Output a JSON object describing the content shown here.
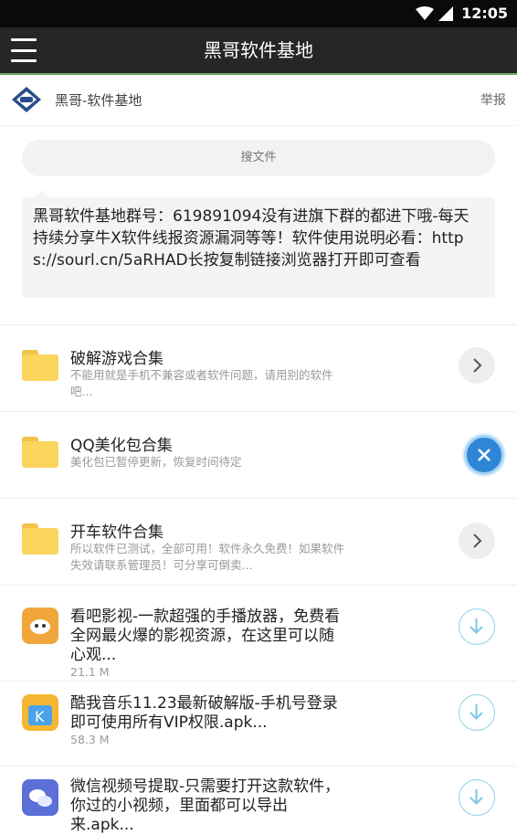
{
  "status_bar": {
    "time": "12:05"
  },
  "app_bar": {
    "title": "黑哥软件基地",
    "menu_icon": "hamburger-icon"
  },
  "header": {
    "name": "黑哥-软件基地",
    "report_label": "举报"
  },
  "search": {
    "placeholder": "搜文件"
  },
  "notice": {
    "text": "黑哥软件基地群号：619891094没有进旗下群的都进下哦-每天持续分享牛X软件线报资源漏洞等等！软件使用说明必看：https://sourl.cn/5aRHAD长按复制链接浏览器打开即可查看"
  },
  "folders": [
    {
      "title": "破解游戏合集",
      "desc": "不能用就是手机不兼容或者软件问题，请用别的软件吧..."
    },
    {
      "title": "QQ美化包合集",
      "desc": "美化包已暂停更新，恢复时间待定"
    },
    {
      "title": "开车软件合集",
      "desc": "所以软件已测试，全部可用！软件永久免费！如果软件失效请联系管理员！可分享可倒卖..."
    }
  ],
  "files": [
    {
      "title": "看吧影视-一款超强的手播放器，免费看全网最火爆的影视资源，在这里可以随心观...",
      "size": "21.1 M",
      "icon": "kanba-app-icon",
      "color": "#f0a63a"
    },
    {
      "title": "酷我音乐11.23最新破解版-手机号登录即可使用所有VIP权限.apk...",
      "size": "58.3 M",
      "icon": "kuwo-app-icon",
      "color": "#f5b731"
    },
    {
      "title": "微信视频号提取-只需要打开这款软件，你过的小视频，里面都可以导出来.apk...",
      "size": "",
      "icon": "wechat-video-app-icon",
      "color": "#5b6fd6"
    }
  ],
  "colors": {
    "appbar": "#262626",
    "accent_circle": "#8fd0e8",
    "folder": "#fbd55e"
  }
}
